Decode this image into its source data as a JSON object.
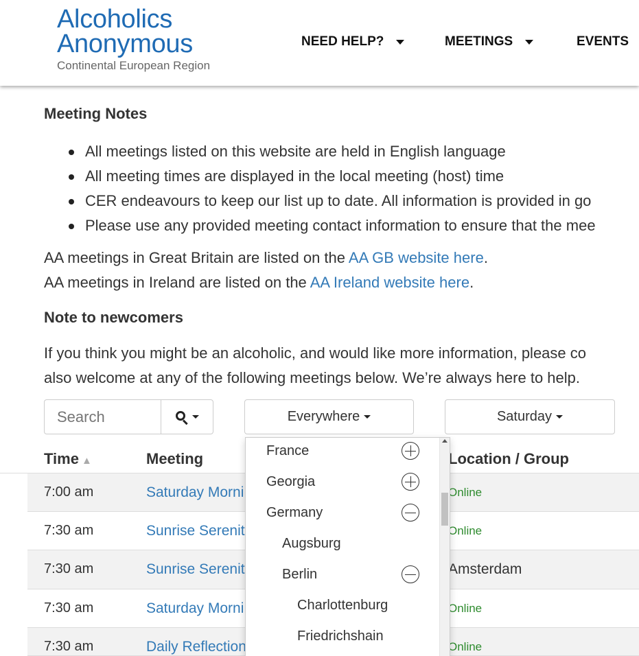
{
  "header": {
    "logo": {
      "line1": "Alcoholics",
      "line2": "Anonymous",
      "line3": "Continental European Region"
    },
    "nav": [
      {
        "label": "NEED HELP?"
      },
      {
        "label": "MEETINGS"
      },
      {
        "label": "EVENTS"
      }
    ]
  },
  "notes": {
    "title": "Meeting Notes",
    "items": [
      "All meetings listed on this website are held in English language",
      "All meeting times are displayed in the local meeting (host) time",
      "CER endeavours to keep our list up to date. All information is provided in go",
      "Please use any provided meeting contact information to ensure that the mee"
    ]
  },
  "links": {
    "gb_prefix": "AA meetings in Great Britain are listed on the ",
    "gb_link": "AA GB website here",
    "gb_suffix": ".",
    "ie_prefix": "AA meetings in Ireland are listed on the ",
    "ie_link": "AA Ireland website here",
    "ie_suffix": "."
  },
  "newcomers": {
    "title": "Note to newcomers",
    "line1": "If you think you might be an alcoholic, and would like more information, please co",
    "line2": "also welcome at any of the following meetings below. We’re always here to help."
  },
  "controls": {
    "search_placeholder": "Search",
    "region_label": "Everywhere",
    "day_label": "Saturday"
  },
  "table": {
    "headers": {
      "time": "Time",
      "meeting": "Meeting",
      "location": "Location / Group"
    },
    "rows": [
      {
        "time": "7:00 am",
        "meeting": "Saturday Morni",
        "location": "Online"
      },
      {
        "time": "7:30 am",
        "meeting": "Sunrise Serenity",
        "location": "Online"
      },
      {
        "time": "7:30 am",
        "meeting": "Sunrise Serenity",
        "location": "Amsterdam"
      },
      {
        "time": "7:30 am",
        "meeting": "Saturday Morni",
        "location": "Online"
      },
      {
        "time": "7:30 am",
        "meeting": "Daily Reflection",
        "location": "Online"
      }
    ]
  },
  "region_dropdown": {
    "items": [
      {
        "label": "France",
        "state": "plus"
      },
      {
        "label": "Georgia",
        "state": "plus"
      },
      {
        "label": "Germany",
        "state": "minus"
      },
      {
        "label": "Augsburg",
        "state": "none"
      },
      {
        "label": "Berlin",
        "state": "minus"
      },
      {
        "label": "Charlottenburg",
        "state": "none"
      },
      {
        "label": "Friedrichshain",
        "state": "none"
      }
    ]
  },
  "colors": {
    "brand_blue": "#1f6bb4",
    "link_blue": "#337ab7",
    "online_green": "#2e8b2e",
    "row_stripe": "#f2f2f2"
  }
}
